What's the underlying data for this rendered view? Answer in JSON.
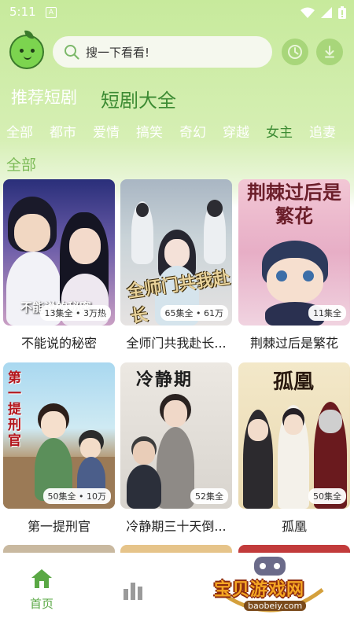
{
  "status_bar": {
    "time": "5:11",
    "notif": "A"
  },
  "header": {
    "search_placeholder": "搜一下看看!"
  },
  "main_tabs": [
    {
      "label": "推荐短剧"
    },
    {
      "label": "短剧大全"
    }
  ],
  "categories": [
    "全部",
    "都市",
    "爱情",
    "搞笑",
    "奇幻",
    "穿越",
    "女主",
    "追妻"
  ],
  "section_title": "全部",
  "dramas": [
    {
      "title": "不能说的秘密",
      "badge": "13集全 • 3万热",
      "poster_text": "不能说的秘密"
    },
    {
      "title": "全师门共我赴长...",
      "badge": "65集全 • 61万",
      "poster_text": "全师门共我赴长"
    },
    {
      "title": "荆棘过后是繁花",
      "badge": "11集全",
      "poster_text": "荆棘过后是繁花"
    },
    {
      "title": "第一提刑官",
      "badge": "50集全 • 10万",
      "poster_text": "第一提刑官"
    },
    {
      "title": "冷静期三十天倒...",
      "badge": "52集全",
      "poster_text": "冷静期"
    },
    {
      "title": "孤凰",
      "badge": "50集全",
      "poster_text": "孤凰"
    }
  ],
  "bottom_nav": {
    "home_label": "首页"
  },
  "watermark": {
    "main": "宝贝游戏网",
    "sub": "baobeiy.com"
  },
  "colors": {
    "accent": "#3c8b33",
    "header_bg": "#c7ea9c",
    "nav_active": "#5aa845"
  }
}
